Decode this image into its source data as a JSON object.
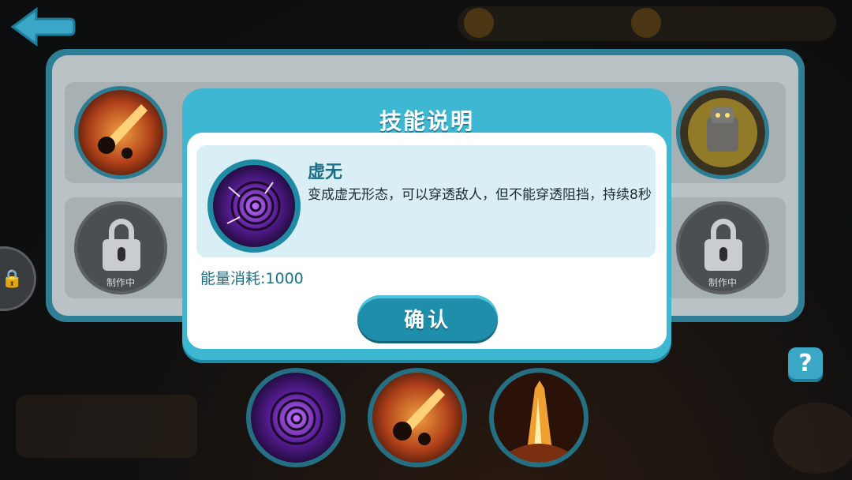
{
  "dialog": {
    "title": "技能说明",
    "skill_name": "虚无",
    "skill_description": "变成虚无形态，可以穿透敌人，但不能穿透阻挡，持续8秒",
    "energy_cost": "能量消耗:1000",
    "confirm_label": "确认"
  },
  "panel": {
    "locked_slot_label": "制作中"
  },
  "help": {
    "label": "?"
  },
  "colors": {
    "dialog_frame": "#3db7d2",
    "card_background": "#daeff5",
    "confirm_button": "#1e8eaa",
    "accent_text": "#1d6f85"
  },
  "icons": {
    "back": "back-arrow-icon",
    "void_skill": "void-vortex-icon",
    "meteor_skill": "meteor-icon",
    "fire_pillar_skill": "fire-pillar-icon",
    "stone_golem_skill": "golem-icon",
    "lock": "lock-icon"
  }
}
